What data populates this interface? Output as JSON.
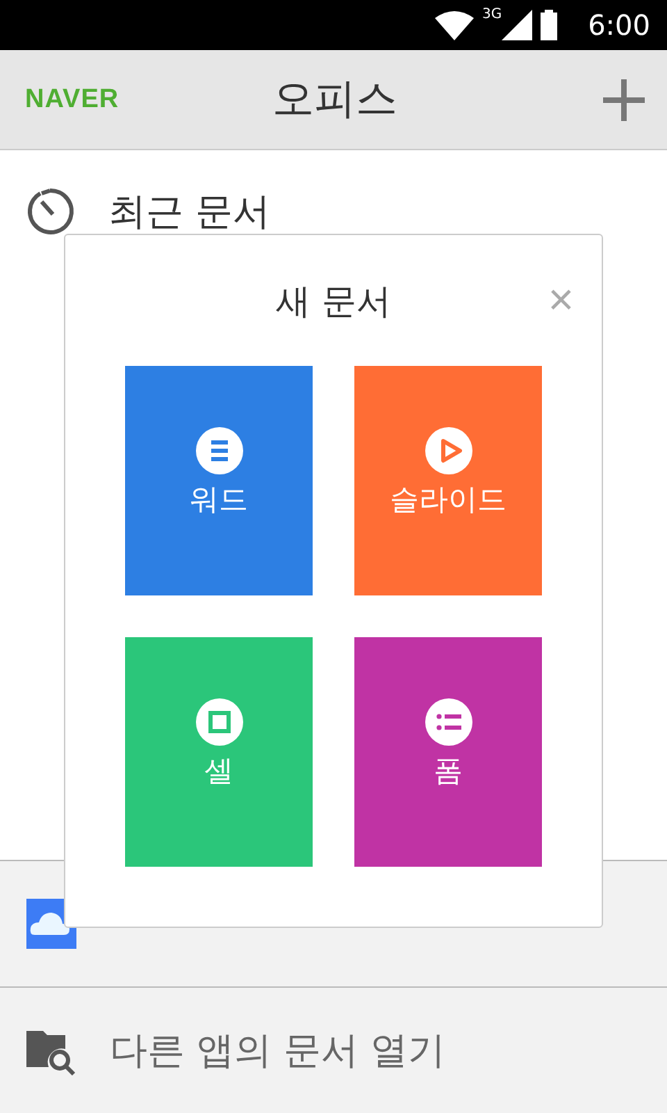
{
  "status_bar": {
    "network": "3G",
    "time": "6:00"
  },
  "app_bar": {
    "logo": "NAVER",
    "title": "오피스"
  },
  "recent": {
    "label": "최근 문서"
  },
  "dialog": {
    "title": "새 문서",
    "close": "×",
    "tiles": [
      {
        "kind": "word",
        "label": "워드",
        "color": "#2d7fe3"
      },
      {
        "kind": "slide",
        "label": "슬라이드",
        "color": "#ff6d35"
      },
      {
        "kind": "cell",
        "label": "셀",
        "color": "#2bc67a"
      },
      {
        "kind": "form",
        "label": "폼",
        "color": "#c033a4"
      }
    ]
  },
  "bottom_items": [
    {
      "kind": "cloud"
    },
    {
      "kind": "folder",
      "label": "다른 앱의 문서 열기"
    }
  ]
}
